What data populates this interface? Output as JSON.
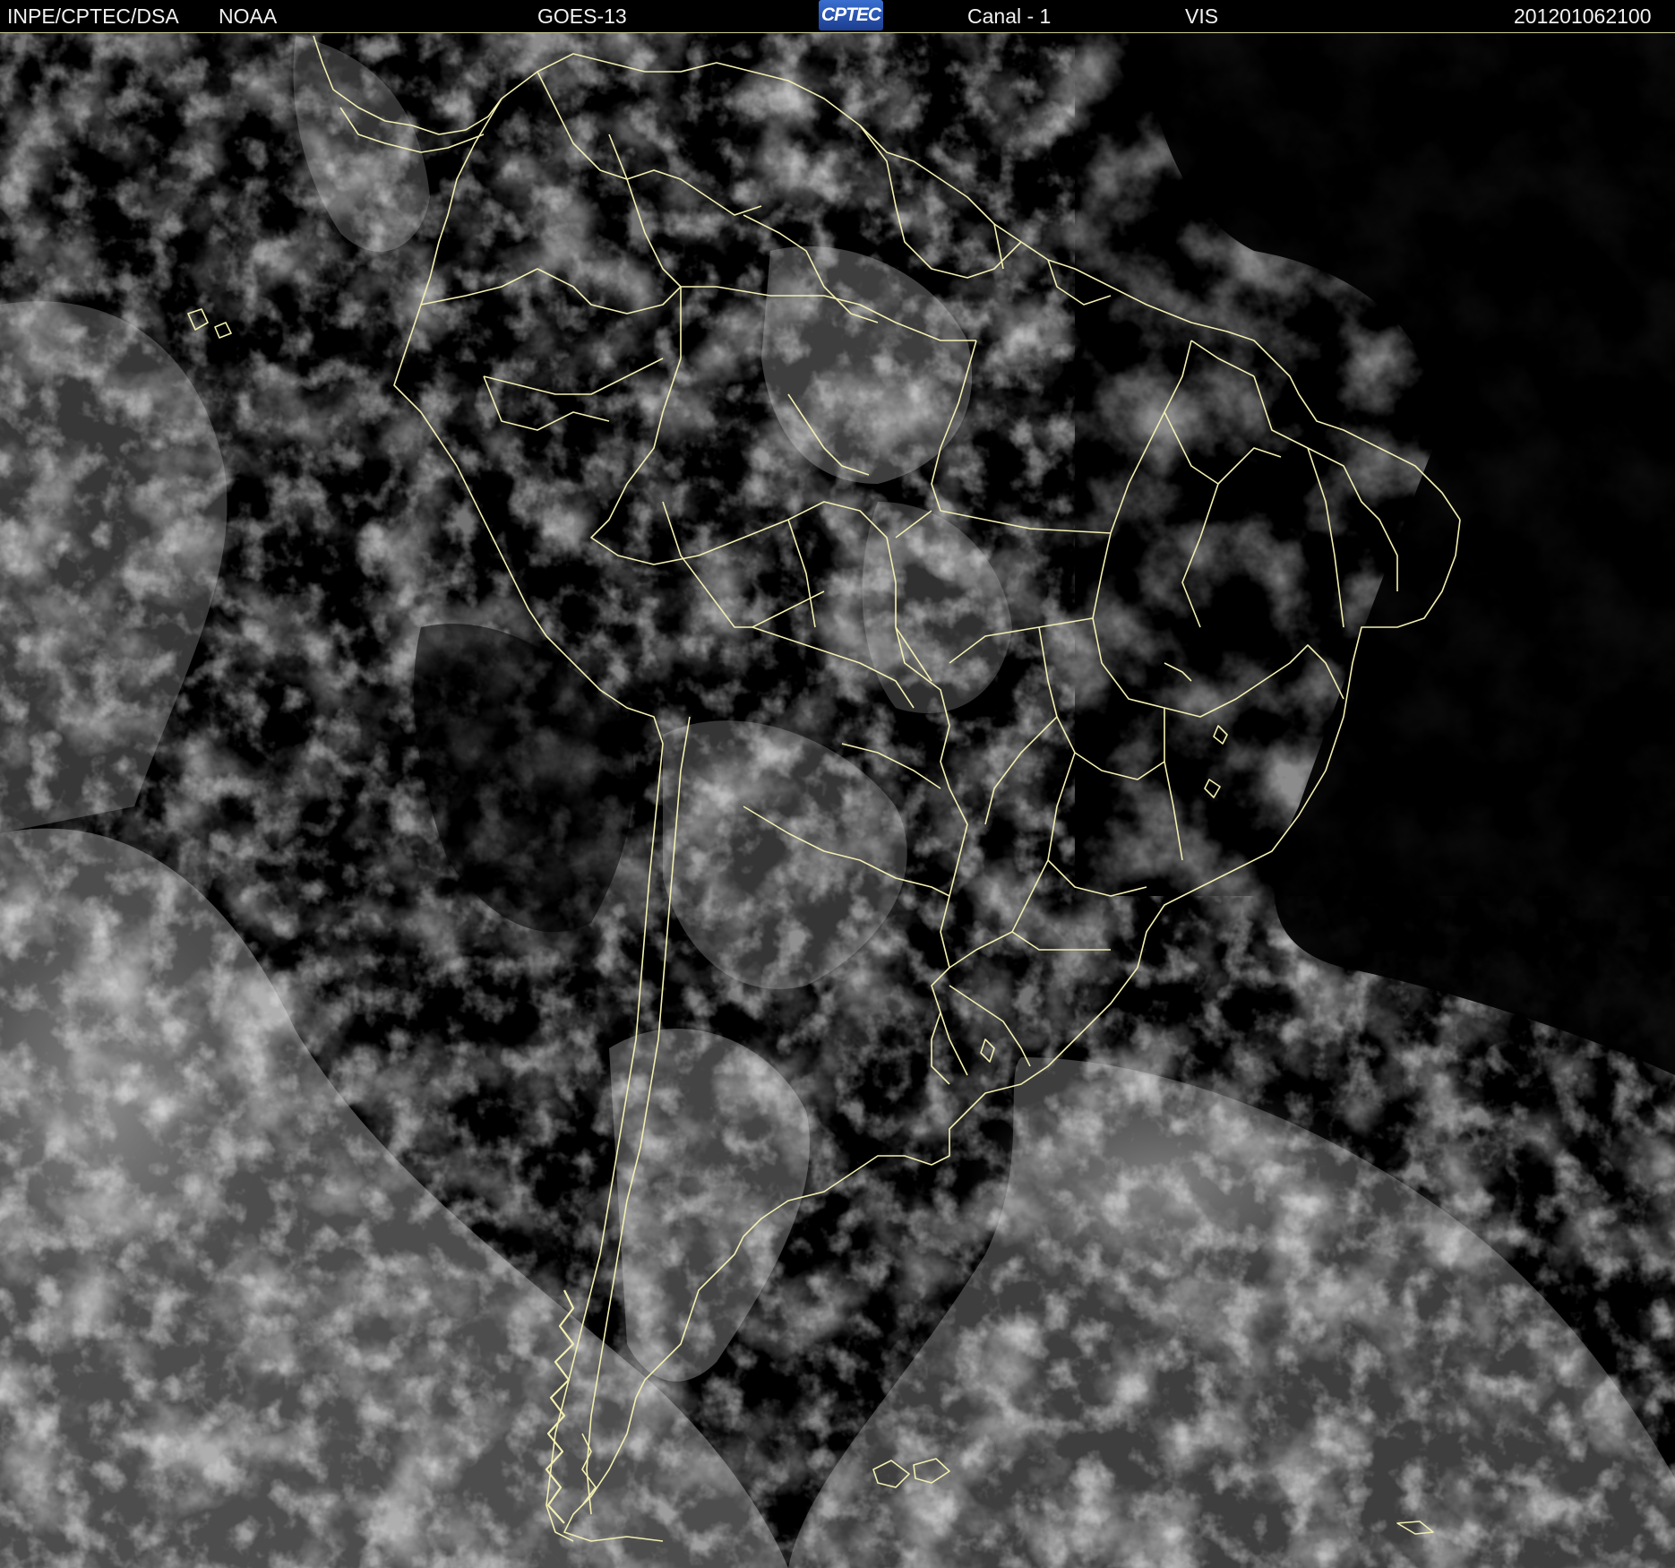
{
  "header": {
    "institution": "INPE/CPTEC/DSA",
    "agency": "NOAA",
    "satellite": "GOES-13",
    "logo_text": "CPTEC",
    "channel": "Canal - 1",
    "band": "VIS",
    "timestamp": "201201062100"
  },
  "colors": {
    "background": "#000000",
    "border_lines": "#f3efb0",
    "header_text": "#f2f2f2"
  }
}
